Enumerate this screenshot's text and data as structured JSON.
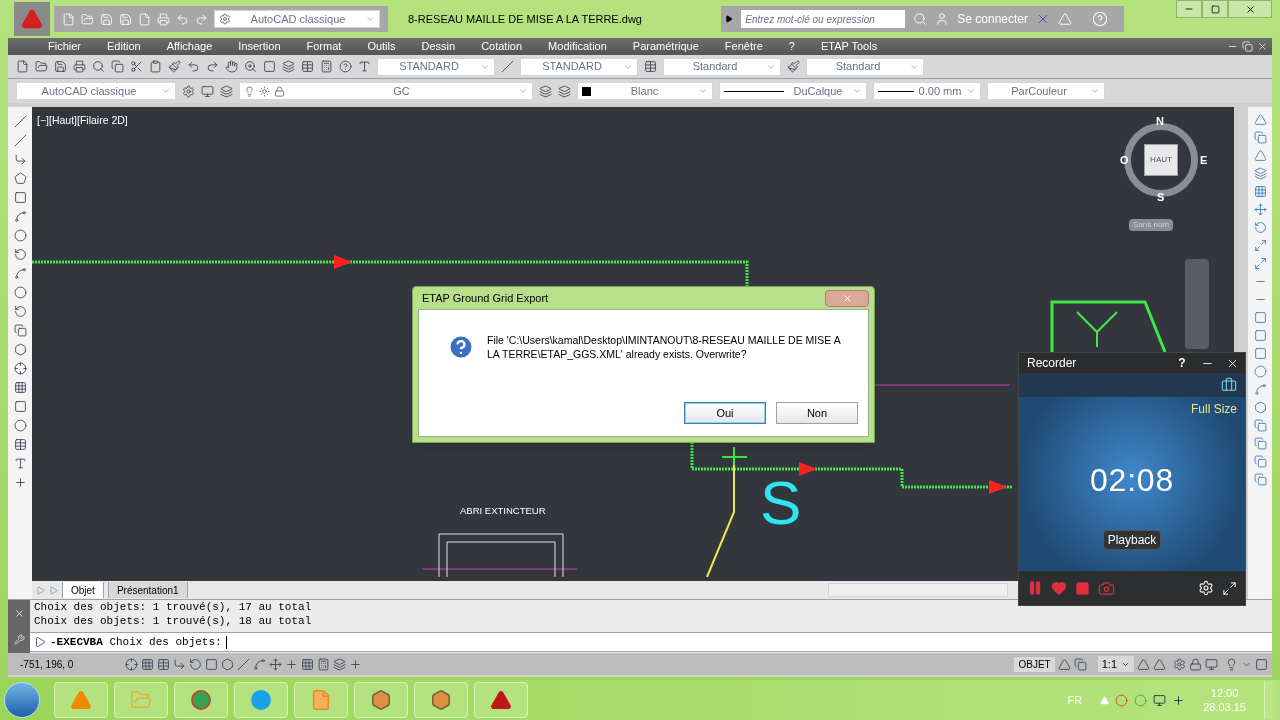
{
  "title_bar": {
    "workspace": "AutoCAD classique",
    "title": "8-RESEAU MAILLE DE MISE A LA TERRE.dwg",
    "search": {
      "placeholder": "Entrez mot-clé ou expression"
    },
    "sign_in": "Se connecter"
  },
  "menu_bar": {
    "items": [
      "Fichier",
      "Edition",
      "Affichage",
      "Insertion",
      "Format",
      "Outils",
      "Dessin",
      "Cotation",
      "Modification",
      "Paramétrique",
      "Fenêtre",
      "?",
      "ETAP Tools"
    ]
  },
  "toolbar": {
    "styles": [
      "STANDARD",
      "STANDARD",
      "Standard",
      "Standard"
    ]
  },
  "properties_bar": {
    "workspace": "AutoCAD classique",
    "layer": "GC",
    "current_colour": "Blanc",
    "linetype": "DuCalque",
    "lineweight": "0.00 mm",
    "plot_style": "ParCouleur"
  },
  "viewport": {
    "label": "[−][Haut][Filaire 2D]",
    "compass": {
      "north": "N",
      "south": "S",
      "east": "E",
      "west": "O",
      "face": "HAUT"
    },
    "ucs": "Sans nom",
    "texts": [
      {
        "kind": "label",
        "text": "ABRI EXTINCTEUR"
      },
      {
        "kind": "symbol",
        "text": "S"
      }
    ]
  },
  "layout_tabs": [
    {
      "label": "Objet",
      "selected": true
    },
    {
      "label": "Présentation1",
      "selected": false
    }
  ],
  "command_history": [
    "Choix des objets: 1 trouvé(s), 17 au total",
    "Choix des objets: 1 trouvé(s), 18 au total"
  ],
  "command_line": {
    "command": "-EXECVBA",
    "prompt": "Choix des objets:"
  },
  "status_bar": {
    "coordinates": "-751, 196, 0",
    "space": "OBJET",
    "scale": "1:1"
  },
  "dialog": {
    "title": "ETAP Ground Grid Export",
    "message": "File 'C:\\Users\\kamal\\Desktop\\IMINTANOUT\\8-RESEAU MAILLE DE MISE A LA TERRE\\ETAP_GGS.XML' already exists. Overwrite?",
    "buttons": [
      {
        "label": "Oui",
        "selected": true
      },
      {
        "label": "Non",
        "selected": false
      }
    ]
  },
  "recorder": {
    "title": "Recorder",
    "help": "?",
    "size_label": "Full Size",
    "time": "02:08",
    "playback": "Playback"
  },
  "taskbar": {
    "language": "FR",
    "time": "12:00",
    "date": "28.03.15"
  }
}
